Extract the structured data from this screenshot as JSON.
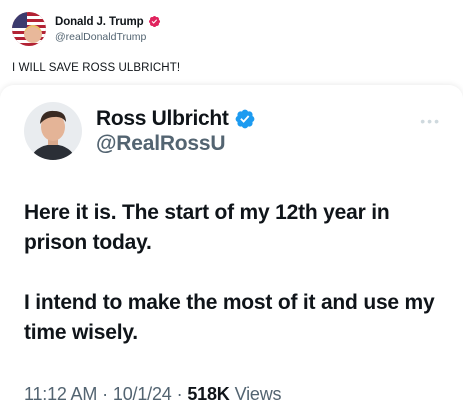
{
  "outer_post": {
    "author_name": "Donald J. Trump",
    "handle": "@realDonaldTrump",
    "verified_badge_icon": "verified-badge-icon",
    "text": "I WILL SAVE ROSS ULBRICHT!"
  },
  "quoted_post": {
    "author_name": "Ross Ulbricht",
    "handle": "@RealRossU",
    "verified_badge_icon": "verified-badge-icon",
    "paragraphs": [
      "Here it is. The start of my 12th year in prison today.",
      "I intend to make the most of it and use my time wisely."
    ],
    "time": "11:12 AM",
    "separator": "·",
    "date": "10/1/24",
    "views_count": "518K",
    "views_label": "Views"
  },
  "colors": {
    "text_primary": "#0f1419",
    "text_secondary": "#536471",
    "verified_blue": "#1d9bf0",
    "outer_badge_pink": "#e0245e"
  }
}
